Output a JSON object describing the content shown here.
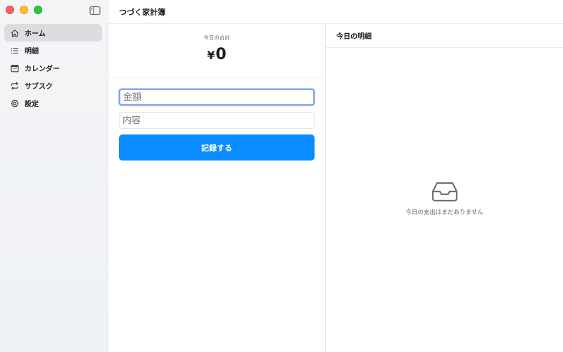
{
  "app": {
    "title": "つづく家計簿"
  },
  "sidebar": {
    "items": [
      {
        "label": "ホーム",
        "icon": "house-icon",
        "active": true
      },
      {
        "label": "明細",
        "icon": "list-icon",
        "active": false
      },
      {
        "label": "カレンダー",
        "icon": "calendar-icon",
        "active": false
      },
      {
        "label": "サブスク",
        "icon": "repeat-icon",
        "active": false
      },
      {
        "label": "設定",
        "icon": "gear-icon",
        "active": false
      }
    ]
  },
  "summary": {
    "label": "今日の合計",
    "currency": "¥",
    "amount": "0"
  },
  "form": {
    "amount_placeholder": "金額",
    "amount_value": "",
    "description_placeholder": "内容",
    "description_value": "",
    "submit_label": "記録する"
  },
  "details": {
    "header": "今日の明細",
    "empty_message": "今日の支出はまだありません",
    "empty_icon": "inbox-icon"
  },
  "colors": {
    "accent": "#0a8bff",
    "focus_ring": "#7fa8e8",
    "sidebar_active": "#dddde0"
  }
}
